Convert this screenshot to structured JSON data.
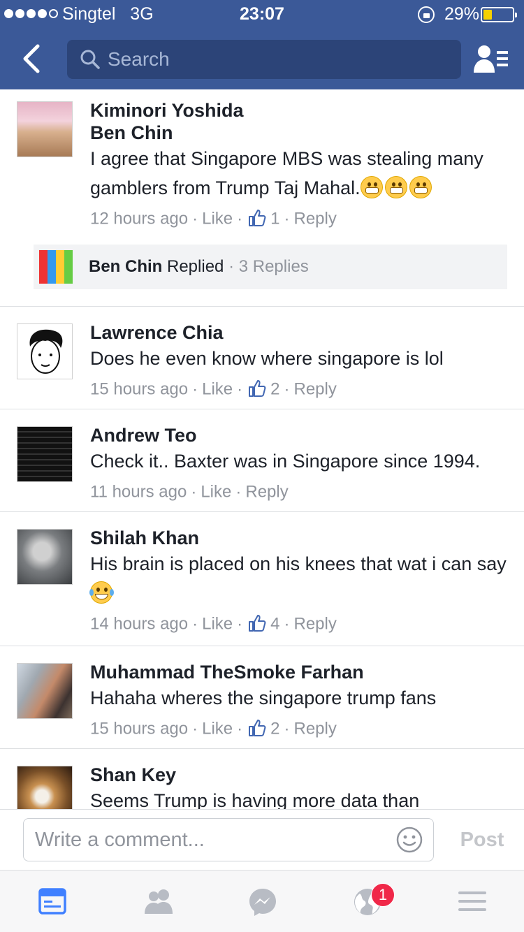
{
  "status_bar": {
    "carrier": "Singtel",
    "network": "3G",
    "time": "23:07",
    "battery": "29%"
  },
  "header": {
    "search_placeholder": "Search"
  },
  "reply_box": {
    "name": "Ben Chin",
    "action": "Replied",
    "count": "3 Replies"
  },
  "comments": [
    {
      "name": "Kiminori Yoshida",
      "tagged": "Ben Chin",
      "text": "I agree that Singapore MBS was stealing many gamblers from Trump Taj Mahal.",
      "emojis": [
        "grinning-face-icon",
        "grinning-face-icon",
        "grinning-face-icon"
      ],
      "time": "12 hours ago",
      "like_label": "Like",
      "likes": "1",
      "reply_label": "Reply"
    },
    {
      "name": "Lawrence Chia",
      "text": "Does he even know where singapore is lol",
      "time": "15 hours ago",
      "like_label": "Like",
      "likes": "2",
      "reply_label": "Reply"
    },
    {
      "name": "Andrew Teo",
      "text": "Check it.. Baxter was in Singapore since 1994.",
      "time": "11 hours ago",
      "like_label": "Like",
      "reply_label": "Reply"
    },
    {
      "name": "Shilah Khan",
      "text": "His brain is placed on his knees that wat i can say",
      "emojis": [
        "tears-of-joy-icon"
      ],
      "time": "14 hours ago",
      "like_label": "Like",
      "likes": "4",
      "reply_label": "Reply"
    },
    {
      "name": "Muhammad TheSmoke Farhan",
      "text": "Hahaha wheres the singapore trump fans",
      "time": "15 hours ago",
      "like_label": "Like",
      "likes": "2",
      "reply_label": "Reply"
    },
    {
      "name": "Shan Key",
      "text": "Seems Trump is having more data than"
    }
  ],
  "composer": {
    "placeholder": "Write a comment...",
    "post_label": "Post"
  },
  "tabbar": {
    "notifications_badge": "1"
  },
  "colors": {
    "brand": "#3b5998",
    "search_bg": "#2c4478",
    "meta_text": "#90949c",
    "active_tab": "#4080ff",
    "badge": "#f02849"
  }
}
